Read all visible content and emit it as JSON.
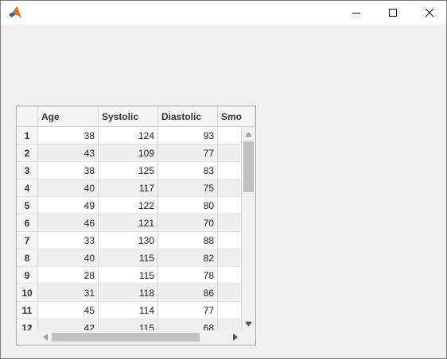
{
  "window": {
    "icon": "matlab-logo-icon",
    "controls": [
      "minimize-icon",
      "maximize-icon",
      "close-icon"
    ]
  },
  "table": {
    "columns": [
      "Age",
      "Systolic",
      "Diastolic",
      "Smo"
    ],
    "rows": [
      {
        "idx": "1",
        "age": "38",
        "systolic": "124",
        "diastolic": "93"
      },
      {
        "idx": "2",
        "age": "43",
        "systolic": "109",
        "diastolic": "77"
      },
      {
        "idx": "3",
        "age": "38",
        "systolic": "125",
        "diastolic": "83"
      },
      {
        "idx": "4",
        "age": "40",
        "systolic": "117",
        "diastolic": "75"
      },
      {
        "idx": "5",
        "age": "49",
        "systolic": "122",
        "diastolic": "80"
      },
      {
        "idx": "6",
        "age": "46",
        "systolic": "121",
        "diastolic": "70"
      },
      {
        "idx": "7",
        "age": "33",
        "systolic": "130",
        "diastolic": "88"
      },
      {
        "idx": "8",
        "age": "40",
        "systolic": "115",
        "diastolic": "82"
      },
      {
        "idx": "9",
        "age": "28",
        "systolic": "115",
        "diastolic": "78"
      },
      {
        "idx": "10",
        "age": "31",
        "systolic": "118",
        "diastolic": "86"
      },
      {
        "idx": "11",
        "age": "45",
        "systolic": "114",
        "diastolic": "77"
      },
      {
        "idx": "12",
        "age": "42",
        "systolic": "115",
        "diastolic": "68"
      }
    ],
    "colors": {
      "row_alt": "#efefef",
      "row": "#ffffff",
      "scroll_thumb": "#c1c1c1"
    }
  }
}
